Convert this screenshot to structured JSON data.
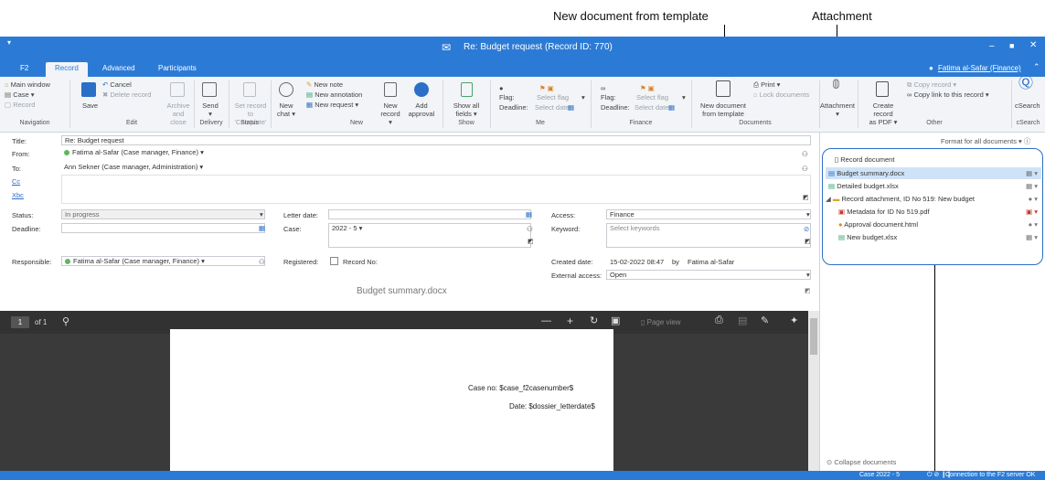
{
  "callouts": {
    "new_doc_template": "New document from template",
    "attachment": "Attachment"
  },
  "window": {
    "title": "Re: Budget request (Record ID: 770)",
    "user": "Fatima al-Safar (Finance)"
  },
  "tabs": [
    "F2",
    "Record",
    "Advanced",
    "Participants"
  ],
  "ribbon": {
    "nav": {
      "main_window": "Main window",
      "case": "Case",
      "record": "Record",
      "group": "Navigation"
    },
    "edit": {
      "save": "Save",
      "cancel": "Cancel",
      "delete": "Delete record",
      "archive": "Archive",
      "and_close": "and close",
      "group": "Edit"
    },
    "delivery": {
      "send": "Send",
      "group": "Delivery"
    },
    "status": {
      "set": "Set record to",
      "complete": "'Complete'",
      "group": "Status"
    },
    "new": {
      "new_chat1": "New",
      "new_chat2": "chat",
      "new_note": "New note",
      "new_annotation": "New annotation",
      "new_request": "New request",
      "new_record1": "New",
      "new_record2": "record",
      "add_approval1": "Add",
      "add_approval2": "approval",
      "group": "New"
    },
    "show": {
      "show_all1": "Show all",
      "show_all2": "fields",
      "group": "Show"
    },
    "me": {
      "flag": "Flag:",
      "deadline": "Deadline:",
      "select_flag": "Select flag",
      "select_date": "Select date",
      "group": "Me"
    },
    "finance": {
      "flag": "Flag:",
      "deadline": "Deadline:",
      "select_flag": "Select flag",
      "select_date": "Select date",
      "group": "Finance"
    },
    "documents": {
      "new_doc1": "New document",
      "new_doc2": "from template",
      "print": "Print",
      "lock": "Lock documents",
      "group": "Documents"
    },
    "attachment": {
      "label": "Attachment"
    },
    "other": {
      "create_pdf1": "Create record",
      "create_pdf2": "as PDF",
      "copy_record": "Copy record",
      "copy_link": "Copy link to this record",
      "group": "Other"
    },
    "csearch": {
      "label": "cSearch",
      "group": "cSearch"
    }
  },
  "form": {
    "title_label": "Title:",
    "title_value": "Re: Budget request",
    "from_label": "From:",
    "from_value": "Fatima al-Safar (Case manager, Finance)",
    "to_label": "To:",
    "to_value": "Ann Sekner (Case manager, Administration)",
    "cc_label": "Cc",
    "bcc_label": "Xbc",
    "status_label": "Status:",
    "status_value": "In progress",
    "deadline_label": "Deadline:",
    "letter_date_label": "Letter date:",
    "case_label": "Case:",
    "case_value": "2022 - 5",
    "access_label": "Access:",
    "access_value": "Finance",
    "keyword_label": "Keyword:",
    "keyword_placeholder": "Select keywords",
    "responsible_label": "Responsible:",
    "responsible_value": "Fatima al-Safar (Case manager, Finance)",
    "registered_label": "Registered:",
    "record_no_label": "Record No:",
    "created_label": "Created date:",
    "created_value": "15-02-2022 08:47",
    "by_label": "by",
    "created_by": "Fatima al-Safar",
    "external_label": "External access:",
    "external_value": "Open"
  },
  "viewer": {
    "doc_title": "Budget summary.docx",
    "page": "1",
    "of": "of 1",
    "page_view": "Page view",
    "case_no": "Case no: $case_f2casenumber$",
    "date": "Date: $dossier_letterdate$"
  },
  "docs": {
    "format_all": "Format for all documents",
    "record_document": "Record document",
    "items": [
      {
        "name": "Budget summary.docx"
      },
      {
        "name": "Detailed budget.xlsx"
      },
      {
        "name": "Record attachment, ID No 519: New budget"
      },
      {
        "name": "Metadata for ID No 519.pdf"
      },
      {
        "name": "Approval document.html"
      },
      {
        "name": "New budget.xlsx"
      }
    ],
    "collapse": "Collapse documents"
  },
  "status": {
    "case": "Case 2022 - 5",
    "connection": "Connection to the F2 server OK"
  }
}
